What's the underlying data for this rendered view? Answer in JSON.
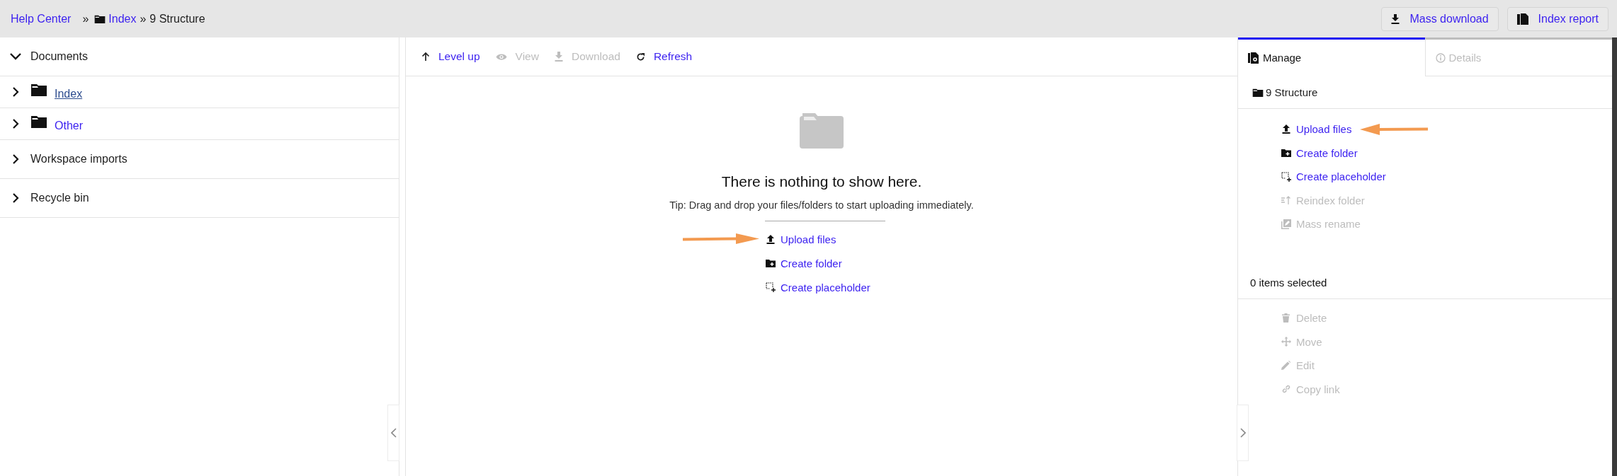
{
  "breadcrumb": [
    {
      "kind": "link",
      "label": "Help Center"
    },
    {
      "kind": "separator",
      "label": "»"
    },
    {
      "kind": "folder-link",
      "label": "Index"
    },
    {
      "kind": "separator",
      "label": "»"
    },
    {
      "kind": "current",
      "label": "9 Structure"
    }
  ],
  "header_buttons": [
    {
      "label": "Mass download"
    },
    {
      "label": "Index report"
    }
  ],
  "tree": [
    {
      "label": "Documents",
      "expanded": true,
      "children": [
        {
          "label": "Index",
          "expanded": false,
          "selected": true
        },
        {
          "label": "Other",
          "expanded": false,
          "selected": false
        }
      ]
    },
    {
      "label": "Workspace imports",
      "expanded": false
    },
    {
      "label": "Recycle bin",
      "expanded": false
    }
  ],
  "toolbar": [
    {
      "label": "Level up",
      "disabled": false
    },
    {
      "label": "View",
      "disabled": true
    },
    {
      "label": "Download",
      "disabled": true
    },
    {
      "label": "Refresh",
      "disabled": false
    }
  ],
  "empty_state": {
    "title": "There is nothing to show here.",
    "tip": "Tip: Drag and drop your files/folders to start uploading immediately.",
    "actions": [
      {
        "label": "Upload files",
        "arrow": true
      },
      {
        "label": "Create folder"
      },
      {
        "label": "Create placeholder"
      }
    ]
  },
  "side_panel": {
    "tabs": [
      {
        "label": "Manage",
        "selected": true
      },
      {
        "label": "Details",
        "selected": false
      }
    ],
    "folder": "9 Structure",
    "actions": [
      {
        "label": "Upload files",
        "disabled": false,
        "arrow": true
      },
      {
        "label": "Create folder",
        "disabled": false
      },
      {
        "label": "Create placeholder",
        "disabled": false
      },
      {
        "label": "Reindex folder",
        "disabled": true
      },
      {
        "label": "Mass rename",
        "disabled": true
      }
    ],
    "selection_count": "0 items selected",
    "selection_actions": [
      {
        "label": "Delete",
        "disabled": true
      },
      {
        "label": "Move",
        "disabled": true
      },
      {
        "label": "Edit",
        "disabled": true
      },
      {
        "label": "Copy link",
        "disabled": true
      }
    ]
  }
}
